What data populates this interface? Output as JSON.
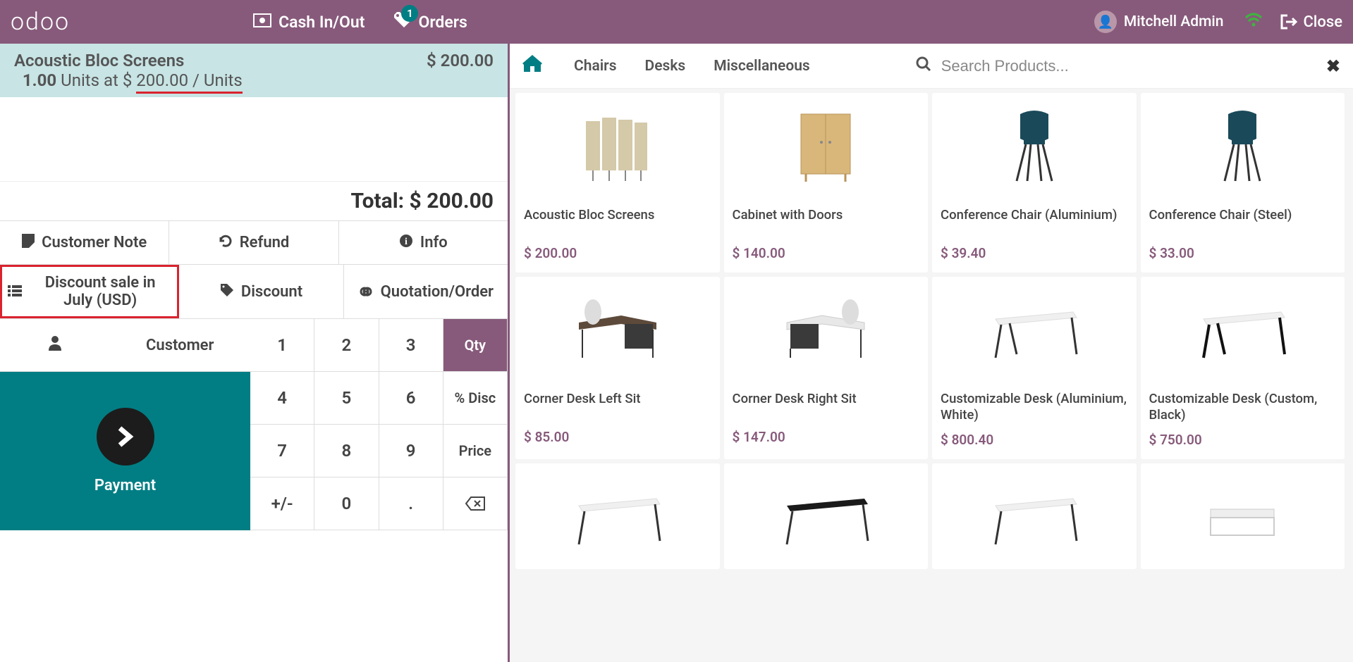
{
  "header": {
    "logo": "odoo",
    "cash_label": "Cash In/Out",
    "orders_label": "Orders",
    "orders_badge": "1",
    "user": "Mitchell Admin",
    "close_label": "Close"
  },
  "order": {
    "product_name": "Acoustic Bloc Screens",
    "qty": "1.00",
    "units_text": "Units at $",
    "unit_price": "200.00 / Units",
    "line_total": "$ 200.00",
    "total_label": "Total: $ 200.00"
  },
  "actions": {
    "customer_note": "Customer Note",
    "refund": "Refund",
    "info": "Info",
    "discount_sale": "Discount sale in July (USD)",
    "discount": "Discount",
    "quotation": "Quotation/Order"
  },
  "controls": {
    "customer": "Customer",
    "payment": "Payment"
  },
  "numpad": {
    "k1": "1",
    "k2": "2",
    "k3": "3",
    "qty": "Qty",
    "k4": "4",
    "k5": "5",
    "k6": "6",
    "disc": "% Disc",
    "k7": "7",
    "k8": "8",
    "k9": "9",
    "price": "Price",
    "pm": "+/-",
    "k0": "0",
    "dot": ".",
    "bksp": "⌫"
  },
  "categories": {
    "c1": "Chairs",
    "c2": "Desks",
    "c3": "Miscellaneous"
  },
  "search": {
    "placeholder": "Search Products..."
  },
  "products": [
    {
      "name": "Acoustic Bloc Screens",
      "price": "$ 200.00"
    },
    {
      "name": "Cabinet with Doors",
      "price": "$ 140.00"
    },
    {
      "name": "Conference Chair (Aluminium)",
      "price": "$ 39.40"
    },
    {
      "name": "Conference Chair (Steel)",
      "price": "$ 33.00"
    },
    {
      "name": "Corner Desk Left Sit",
      "price": "$ 85.00"
    },
    {
      "name": "Corner Desk Right Sit",
      "price": "$ 147.00"
    },
    {
      "name": "Customizable Desk (Aluminium, White)",
      "price": "$ 800.40"
    },
    {
      "name": "Customizable Desk (Custom, Black)",
      "price": "$ 750.00"
    },
    {
      "name": "",
      "price": ""
    },
    {
      "name": "",
      "price": ""
    },
    {
      "name": "",
      "price": ""
    },
    {
      "name": "",
      "price": ""
    }
  ]
}
